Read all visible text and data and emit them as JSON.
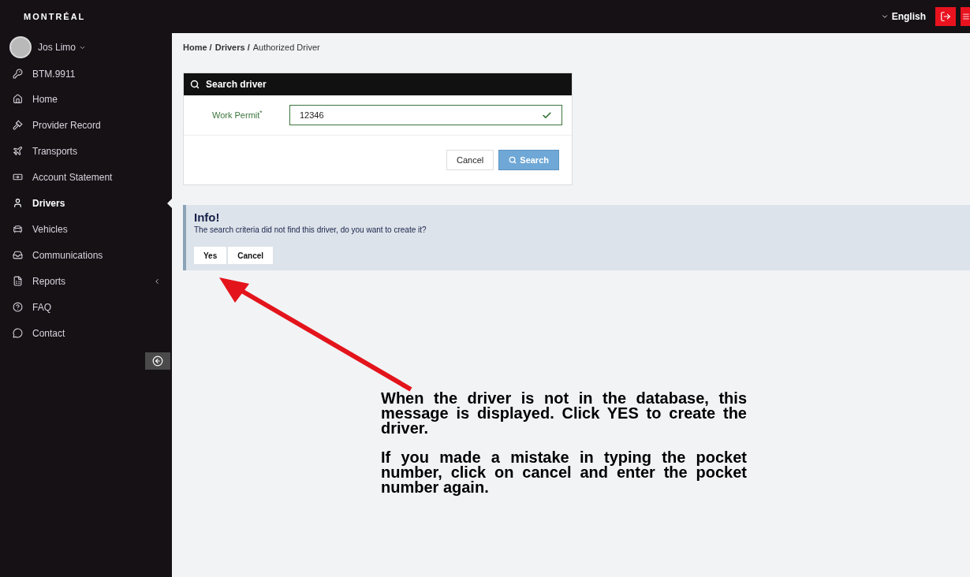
{
  "header": {
    "logo": "MONTRÉAL",
    "language": "English"
  },
  "sidebar": {
    "user": "Jos Limo",
    "account": "BTM.9911",
    "items": [
      {
        "label": "Home",
        "selected": false
      },
      {
        "label": "Provider Record",
        "selected": false
      },
      {
        "label": "Transports",
        "selected": false
      },
      {
        "label": "Account Statement",
        "selected": false
      },
      {
        "label": "Drivers",
        "selected": true
      },
      {
        "label": "Vehicles",
        "selected": false
      },
      {
        "label": "Communications",
        "selected": false
      },
      {
        "label": "Reports",
        "selected": false,
        "expandable": true
      },
      {
        "label": "FAQ",
        "selected": false
      },
      {
        "label": "Contact",
        "selected": false
      }
    ]
  },
  "breadcrumb": [
    "Home /",
    "Drivers /",
    "Authorized Driver"
  ],
  "search_panel": {
    "title": "Search driver",
    "field_label": "Work Permit$^{*}$",
    "field_value": "12346",
    "valid": true,
    "buttons": [
      "Cancel",
      "Search"
    ]
  },
  "info": {
    "title": "Info!",
    "message": "The search criteria did not find this driver, do you want to create it?",
    "buttons": [
      "Yes",
      "Cancel"
    ]
  },
  "annotation": {
    "paragraphs": [
      "When the driver is not in the database, this message is displayed. Click YES to create the driver.",
      "If you made a mistake in typing the pocket number, click on cancel and enter the pocket number again."
    ]
  }
}
